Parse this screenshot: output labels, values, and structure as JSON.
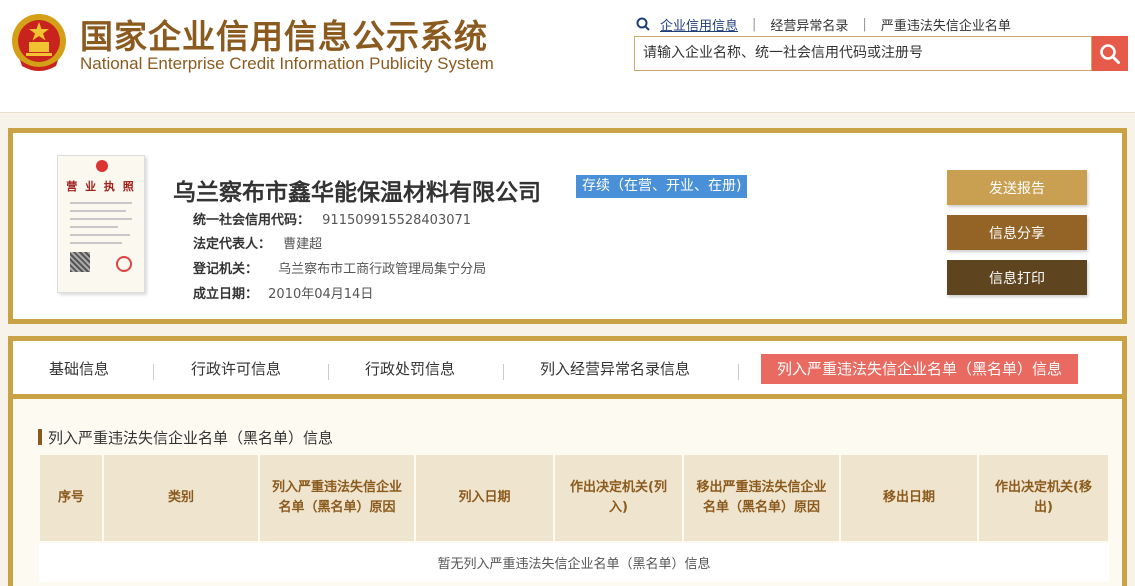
{
  "header": {
    "title_cn": "国家企业信用信息公示系统",
    "title_en": "National Enterprise Credit Information Publicity System",
    "links": [
      "企业信用信息",
      "经营异常名录",
      "严重违法失信企业名单"
    ],
    "search_placeholder": "请输入企业名称、统一社会信用代码或注册号"
  },
  "company": {
    "name": "乌兰察布市鑫华能保温材料有限公司",
    "status": "存续（在营、开业、在册)",
    "license_title": "营 业 执 照",
    "fields": [
      {
        "label": "统一社会信用代码：",
        "value": "911509915528403071"
      },
      {
        "label": "法定代表人：",
        "value": "曹建超"
      },
      {
        "label": "登记机关：",
        "value": "乌兰察布市工商行政管理局集宁分局"
      },
      {
        "label": "成立日期：",
        "value": "2010年04月14日"
      }
    ]
  },
  "actions": {
    "send_report": "发送报告",
    "share": "信息分享",
    "print": "信息打印"
  },
  "tabs": [
    "基础信息",
    "行政许可信息",
    "行政处罚信息",
    "列入经营异常名录信息",
    "列入严重违法失信企业名单（黑名单）信息"
  ],
  "section": {
    "title": "列入严重违法失信企业名单（黑名单）信息",
    "columns": [
      "序号",
      "类别",
      "列入严重违法失信企业名单（黑名单）原因",
      "列入日期",
      "作出决定机关(列入)",
      "移出严重违法失信企业名单（黑名单）原因",
      "移出日期",
      "作出决定机关(移出)"
    ],
    "empty_text": "暂无列入严重违法失信企业名单（黑名单）信息"
  },
  "colors": {
    "brand": "#8b5a1e",
    "gold_border": "#c9a245",
    "active_tab": "#e96a60",
    "status_badge": "#4a90d9",
    "send_report_btn": "#c9a052",
    "share_btn": "#946426",
    "print_btn": "#5e4520",
    "search_btn": "#e65a4a"
  }
}
